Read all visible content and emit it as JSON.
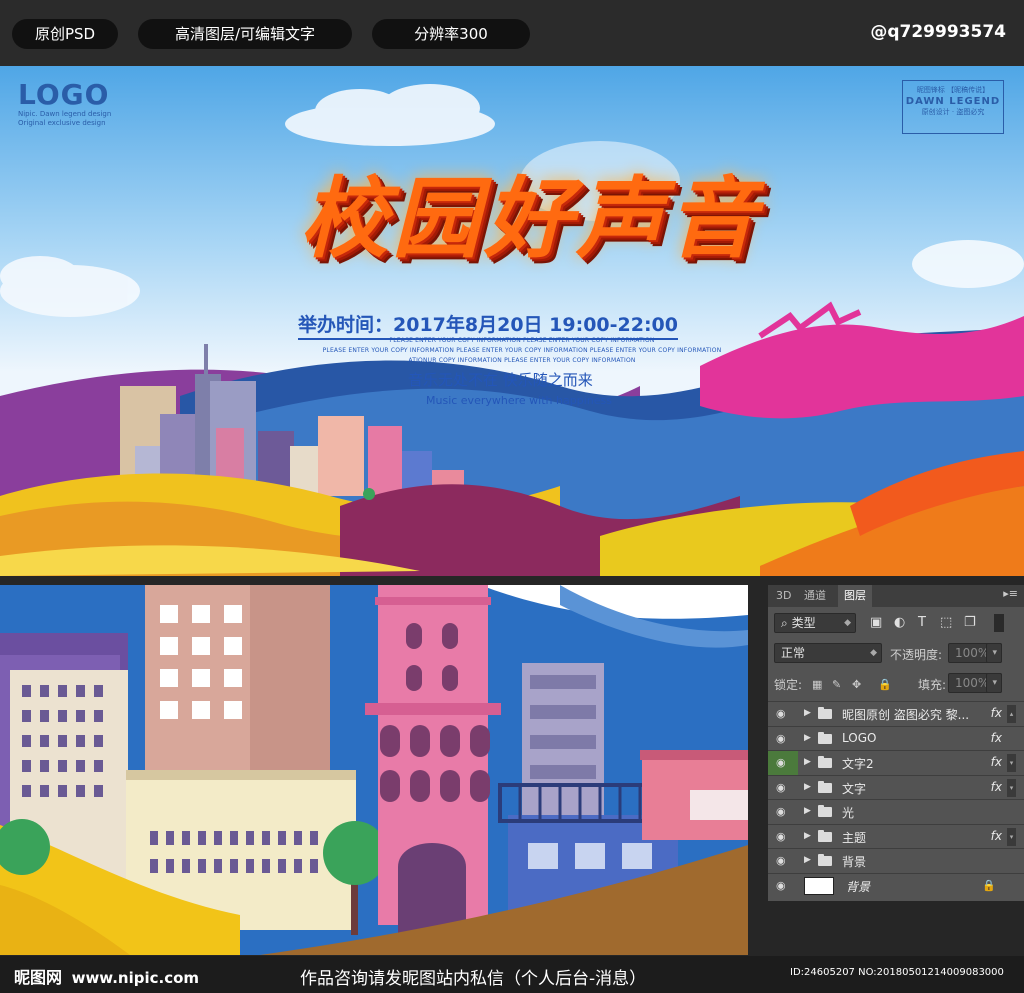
{
  "header": {
    "pill_1": "原创PSD",
    "pill_2": "高清图层/可编辑文字",
    "pill_3": "分辨率300",
    "author": "@q729993574"
  },
  "banner": {
    "logo_text": "LOGO",
    "logo_sub_1": "Nipic. Dawn legend design",
    "logo_sub_2": "Original exclusive design",
    "seal_line_1": "昵图锋标 【昵稿传说】",
    "seal_line_2": "DAWN LEGEND",
    "seal_line_3": "原创设计 · 盗图必究",
    "title": "校园好声音",
    "date_line": "举办时间：2017年8月20日 19:00-22:00",
    "copy_line_1": "PLEASE ENTER YOUR COPY INFORMATION PLEASE ENTER YOUR COPY INFORMATION",
    "copy_line_2": "PLEASE ENTER YOUR COPY INFORMATION PLEASE ENTER YOUR COPY INFORMATION PLEASE ENTER YOUR COPY INFORMATION",
    "copy_line_3": "ATIONUR COPY INFORMATION PLEASE ENTER YOUR COPY INFORMATION",
    "slogan_cn": "音乐无处不在 快乐随之而来",
    "slogan_en": "Music everywhere with happiness"
  },
  "layers_panel": {
    "tabs": [
      "3D",
      "通道",
      "图层"
    ],
    "filter_kind": "类型",
    "blend_mode": "正常",
    "opacity_label": "不透明度:",
    "opacity_value": "100%",
    "lock_label": "锁定:",
    "fill_label": "填充:",
    "fill_value": "100%",
    "layers": [
      {
        "name": "昵图原创 盗图必究 黎...",
        "fx": "fx",
        "type": "group",
        "eye_active": false
      },
      {
        "name": "LOGO",
        "fx": "fx",
        "type": "group",
        "eye_active": false
      },
      {
        "name": "文字2",
        "fx": "fx",
        "type": "group",
        "eye_active": true
      },
      {
        "name": "文字",
        "fx": "fx",
        "type": "group",
        "eye_active": false
      },
      {
        "name": "光",
        "fx": "",
        "type": "group",
        "eye_active": false
      },
      {
        "name": "主题",
        "fx": "fx",
        "type": "group",
        "eye_active": false
      },
      {
        "name": "背景",
        "fx": "",
        "type": "group",
        "eye_active": false
      },
      {
        "name": "背景",
        "fx": "",
        "type": "background",
        "eye_active": false
      }
    ]
  },
  "footer": {
    "watermark": "昵图网",
    "watermark_url": "www.nipic.com",
    "consult": "作品咨询请发昵图站内私信（个人后台-消息）",
    "id_info": "ID:24605207 NO:20180501214009083000"
  },
  "colors": {
    "title_orange": "#ff6a10",
    "text_blue": "#2456b8",
    "panel_gray": "#535353",
    "dark_bg": "#262626"
  }
}
